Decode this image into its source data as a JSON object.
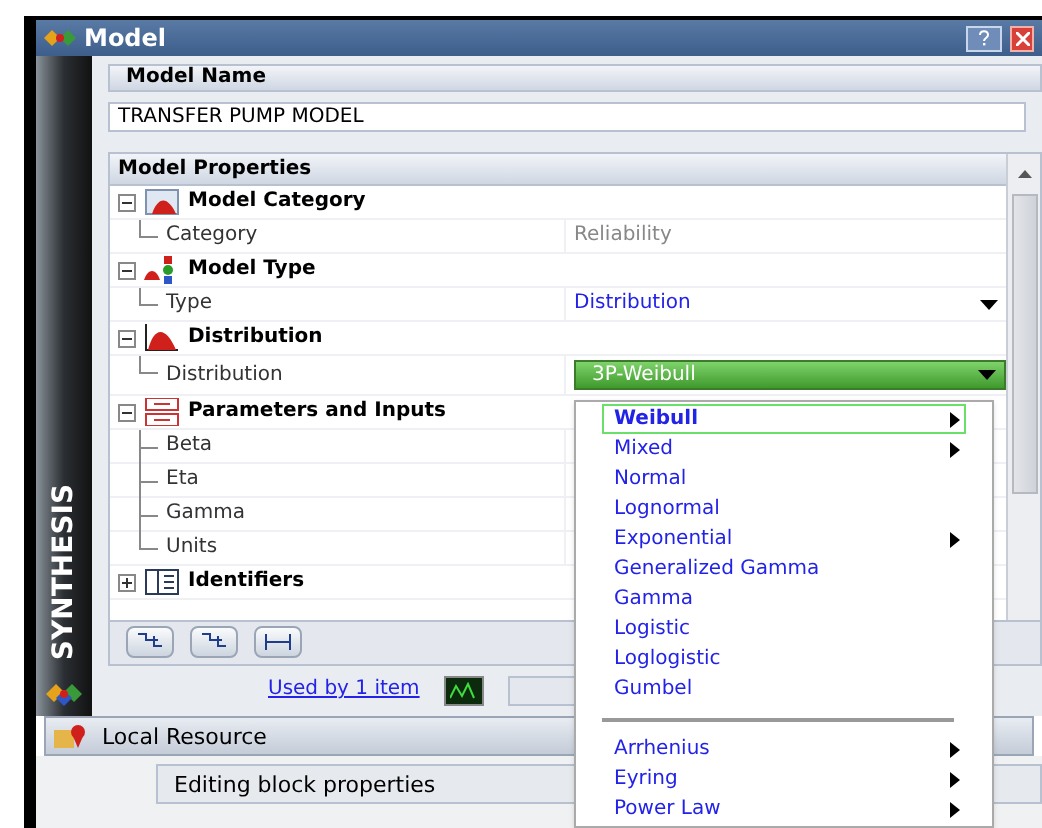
{
  "window": {
    "title": "Model"
  },
  "sidebar": {
    "label": "SYNTHESIS"
  },
  "model_name": {
    "header": "Model Name",
    "value": "TRANSFER PUMP MODEL"
  },
  "properties": {
    "header": "Model Properties",
    "groups": [
      {
        "label": "Model Category",
        "expanded": true,
        "children": [
          {
            "label": "Category",
            "value": "Reliability",
            "kind": "text"
          }
        ]
      },
      {
        "label": "Model Type",
        "expanded": true,
        "children": [
          {
            "label": "Type",
            "value": "Distribution",
            "kind": "dropdown"
          }
        ]
      },
      {
        "label": "Distribution",
        "expanded": true,
        "children": [
          {
            "label": "Distribution",
            "value": "3P-Weibull",
            "kind": "combo"
          }
        ]
      },
      {
        "label": "Parameters and Inputs",
        "expanded": true,
        "children": [
          {
            "label": "Beta"
          },
          {
            "label": "Eta"
          },
          {
            "label": "Gamma"
          },
          {
            "label": "Units"
          }
        ]
      },
      {
        "label": "Identifiers",
        "expanded": false
      }
    ]
  },
  "used_by": "Used by 1 item",
  "local_resource": "Local Resource",
  "status": "Editing block properties",
  "menu": {
    "sections": [
      [
        {
          "label": "Weibull",
          "selected": true,
          "submenu": true
        },
        {
          "label": "Mixed",
          "selected": false,
          "submenu": true
        },
        {
          "label": "Normal",
          "selected": false,
          "submenu": false
        },
        {
          "label": "Lognormal",
          "selected": false,
          "submenu": false
        },
        {
          "label": "Exponential",
          "selected": false,
          "submenu": true
        },
        {
          "label": "Generalized Gamma",
          "selected": false,
          "submenu": false
        },
        {
          "label": "Gamma",
          "selected": false,
          "submenu": false
        },
        {
          "label": "Logistic",
          "selected": false,
          "submenu": false
        },
        {
          "label": "Loglogistic",
          "selected": false,
          "submenu": false
        },
        {
          "label": "Gumbel",
          "selected": false,
          "submenu": false
        }
      ],
      [
        {
          "label": "Arrhenius",
          "selected": false,
          "submenu": true
        },
        {
          "label": "Eyring",
          "selected": false,
          "submenu": true
        },
        {
          "label": "Power Law",
          "selected": false,
          "submenu": true
        }
      ]
    ]
  }
}
